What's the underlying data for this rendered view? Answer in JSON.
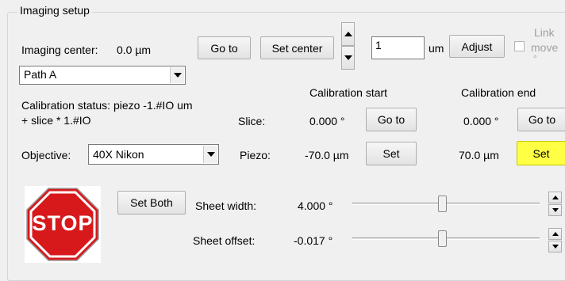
{
  "group": {
    "title": "Imaging setup"
  },
  "imaging_center": {
    "label": "Imaging center:",
    "value": "0.0 µm",
    "goto_label": "Go to",
    "set_center_label": "Set center"
  },
  "step": {
    "value": "1",
    "unit": "um",
    "adjust_label": "Adjust"
  },
  "link_movement": {
    "label_line1": "Link",
    "label_line2": "move",
    "label_line3": "°",
    "checked": false
  },
  "path_select": {
    "selected": "Path A"
  },
  "calibration": {
    "status_line1": "Calibration status: piezo -1.#IO um",
    "status_line2": "+ slice * 1.#IO",
    "start_header": "Calibration start",
    "end_header": "Calibration end",
    "slice_label": "Slice:",
    "piezo_label": "Piezo:",
    "slice_start": "0.000 °",
    "slice_end": "0.000 °",
    "piezo_start": "-70.0 µm",
    "piezo_end": "70.0 µm",
    "goto_label": "Go to",
    "set_label": "Set",
    "set_end_color": "#ffff44"
  },
  "objective": {
    "label": "Objective:",
    "selected": "40X  Nikon"
  },
  "stop": {
    "text": "STOP",
    "color": "#d7191c"
  },
  "set_both": {
    "label": "Set Both"
  },
  "sheet_width": {
    "label": "Sheet width:",
    "value": "4.000 °",
    "slider_fraction": 0.48
  },
  "sheet_offset": {
    "label": "Sheet offset:",
    "value": "-0.017 °",
    "slider_fraction": 0.48
  }
}
